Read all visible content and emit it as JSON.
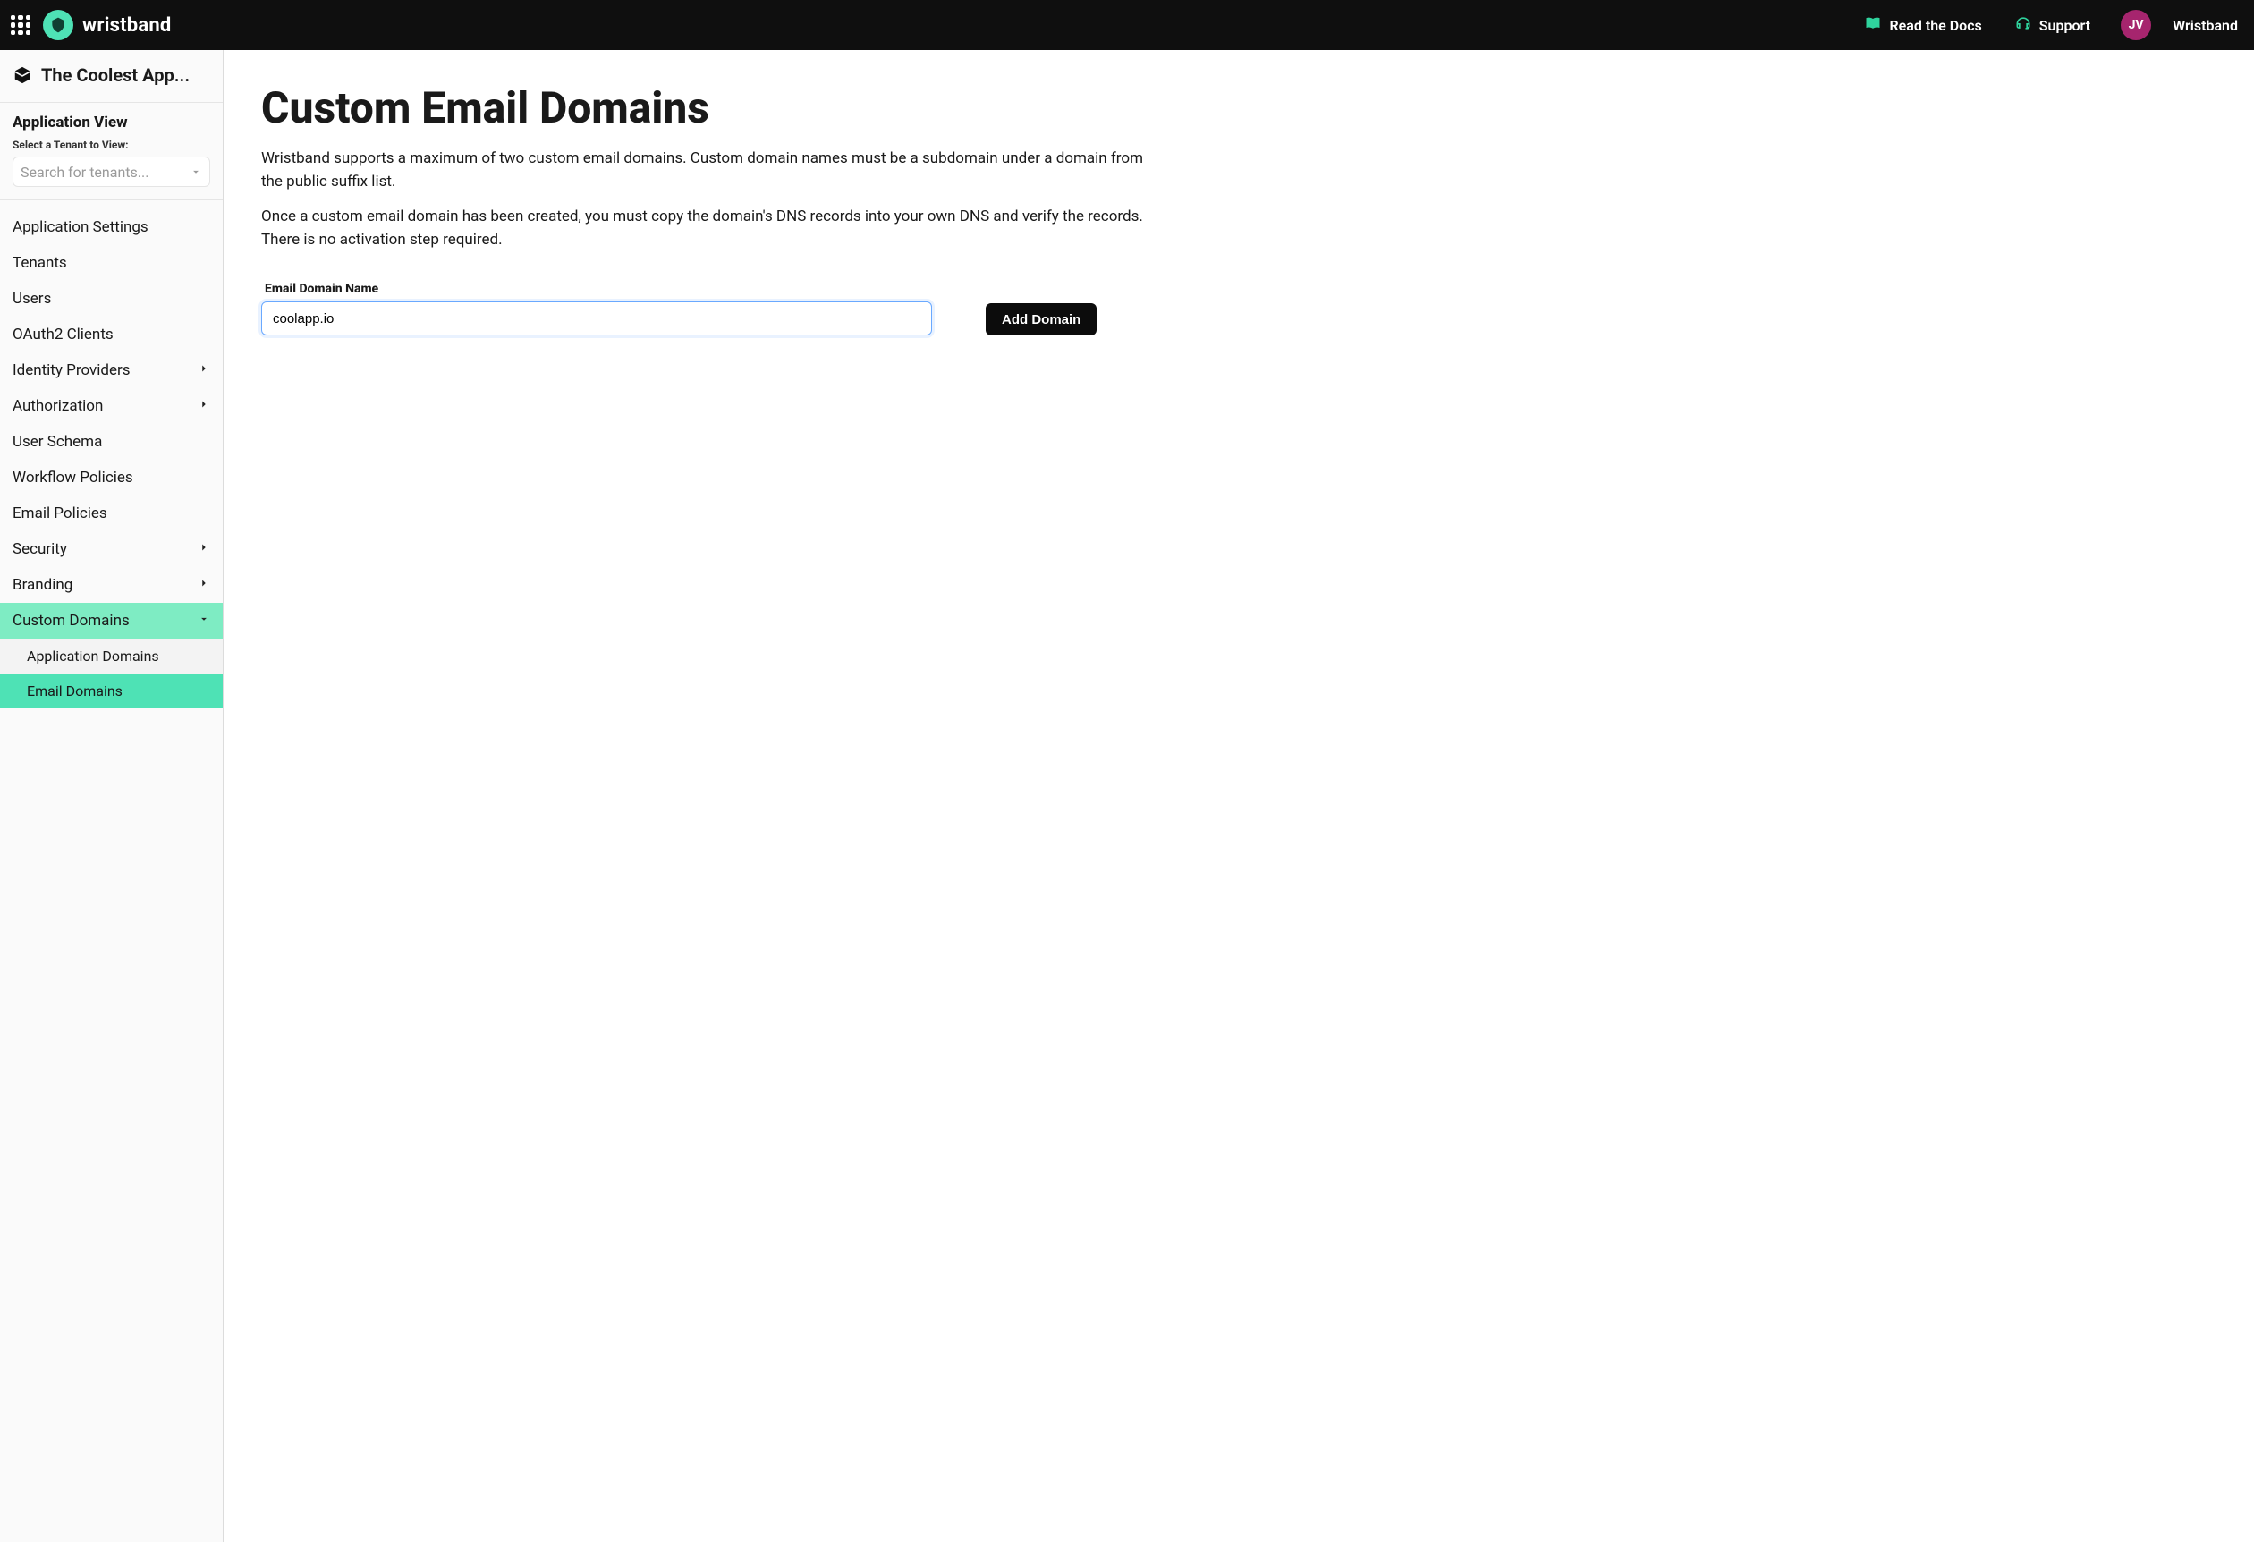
{
  "header": {
    "brand": "wristband",
    "docs_label": "Read the Docs",
    "support_label": "Support",
    "avatar_initials": "JV",
    "tenant_name": "Wristband"
  },
  "sidebar": {
    "app_name": "The Coolest App...",
    "view_title": "Application View",
    "select_label": "Select a Tenant to View:",
    "tenant_placeholder": "Search for tenants...",
    "items": [
      {
        "label": "Application Settings",
        "expandable": false
      },
      {
        "label": "Tenants",
        "expandable": false
      },
      {
        "label": "Users",
        "expandable": false
      },
      {
        "label": "OAuth2 Clients",
        "expandable": false
      },
      {
        "label": "Identity Providers",
        "expandable": true
      },
      {
        "label": "Authorization",
        "expandable": true
      },
      {
        "label": "User Schema",
        "expandable": false
      },
      {
        "label": "Workflow Policies",
        "expandable": false
      },
      {
        "label": "Email Policies",
        "expandable": false
      },
      {
        "label": "Security",
        "expandable": true
      },
      {
        "label": "Branding",
        "expandable": true
      },
      {
        "label": "Custom Domains",
        "expandable": true,
        "open": true,
        "children": [
          {
            "label": "Application Domains",
            "active": false
          },
          {
            "label": "Email Domains",
            "active": true
          }
        ]
      }
    ]
  },
  "main": {
    "title": "Custom Email Domains",
    "desc1": "Wristband supports a maximum of two custom email domains. Custom domain names must be a subdomain under a domain from the public suffix list.",
    "desc2": "Once a custom email domain has been created, you must copy the domain's DNS records into your own DNS and verify the records. There is no activation step required.",
    "form": {
      "label": "Email Domain Name",
      "value": "coolapp.io",
      "button": "Add Domain"
    }
  }
}
